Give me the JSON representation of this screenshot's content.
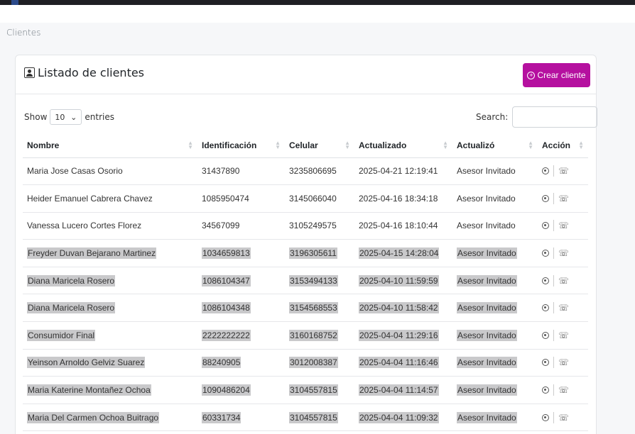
{
  "page": {
    "title": "Clientes"
  },
  "card": {
    "title": "Listado de clientes",
    "create_button": "Crear cliente"
  },
  "controls": {
    "show_label": "Show",
    "entries_value": "10",
    "entries_label": "entries",
    "search_label": "Search:"
  },
  "table": {
    "headers": [
      "Nombre",
      "Identificación",
      "Celular",
      "Actualizado",
      "Actualizó",
      "Acción"
    ],
    "rows": [
      [
        "Maria Jose Casas Osorio",
        "31437890",
        "3235806695",
        "2025-04-21 12:19:41",
        "Asesor Invitado"
      ],
      [
        "Heider Emanuel Cabrera Chavez",
        "1085950474",
        "3145066040",
        "2025-04-16 18:34:18",
        "Asesor Invitado"
      ],
      [
        "Vanessa Lucero Cortes Florez",
        "34567099",
        "3105249575",
        "2025-04-16 18:10:44",
        "Asesor Invitado"
      ],
      [
        "Freyder Duvan Bejarano Martinez",
        "1034659813",
        "3196305611",
        "2025-04-15 14:28:04",
        "Asesor Invitado"
      ],
      [
        "Diana Maricela Rosero",
        "1086104347",
        "3153494133",
        "2025-04-10 11:59:59",
        "Asesor Invitado"
      ],
      [
        "Diana Maricela Rosero",
        "1086104348",
        "3154568553",
        "2025-04-10 11:58:42",
        "Asesor Invitado"
      ],
      [
        "Consumidor Final",
        "2222222222",
        "3160168752",
        "2025-04-04 11:29:16",
        "Asesor Invitado"
      ],
      [
        "Yeinson Arnoldo Gelviz Suarez",
        "88240905",
        "3012008387",
        "2025-04-04 11:16:46",
        "Asesor Invitado"
      ],
      [
        "Maria Katerine Montañez Ochoa",
        "1090486204",
        "3104557815",
        "2025-04-04 11:14:57",
        "Asesor Invitado"
      ],
      [
        "Maria Del Carmen Ochoa Buitrago",
        "60331734",
        "3104557815",
        "2025-04-04 11:09:32",
        "Asesor Invitado"
      ]
    ]
  },
  "icons": {
    "header": "user-card-icon",
    "create": "plus-circle-icon",
    "view": "eye-icon",
    "call": "phone-icon"
  },
  "colors": {
    "primary": "#b5109f"
  }
}
